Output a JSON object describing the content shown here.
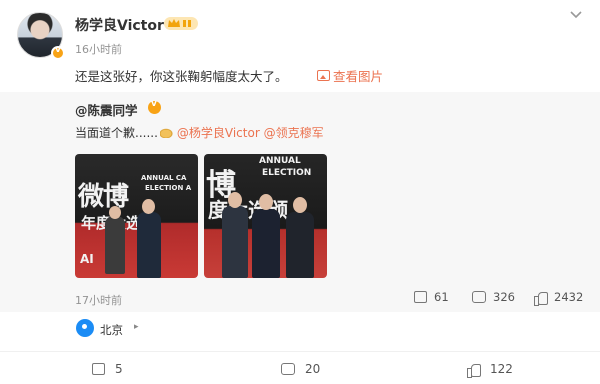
{
  "post": {
    "author": "杨学良Victor",
    "time": "16小时前",
    "text": "还是这张好，你这张鞠躬幅度太大了。",
    "view_pic": "查看图片"
  },
  "repost": {
    "author": "@陈震同学",
    "text_prefix": "当面道个歉......",
    "mention1": "@杨学良Victor",
    "mention2": "@领克穆军",
    "time": "17小时前",
    "shares": "61",
    "comments": "326",
    "likes": "2432",
    "photo1_sign1": "微博",
    "photo1_sign2": "ANNUAL CA",
    "photo1_sign3": "ELECTION A",
    "photo1_sign4": "年度大选颁",
    "photo1_sign5": "AI",
    "photo2_sign1": "博",
    "photo2_sign2": "ANNUAL",
    "photo2_sign3": "ELECTION",
    "photo2_sign4": "度大选颁"
  },
  "location": {
    "label": "北京"
  },
  "footer": {
    "shares": "5",
    "comments": "20",
    "likes": "122"
  },
  "colors": {
    "accent": "#eb7350",
    "badge": "#f8a316",
    "location": "#1b8cf5"
  }
}
